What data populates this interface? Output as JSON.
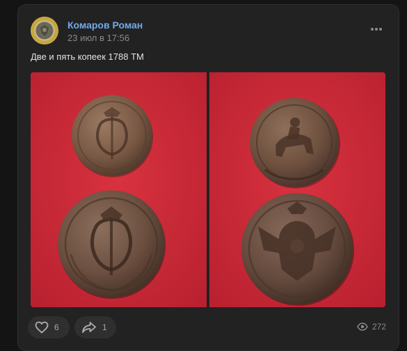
{
  "post": {
    "author": "Комаров Роман",
    "date": "23 июл в 17:56",
    "text": "Две и пять копеек 1788 ТМ",
    "photos": [
      {
        "subject": "coin-obverse-monogram-photo"
      },
      {
        "subject": "coin-reverse-eagle-photo"
      }
    ]
  },
  "actions": {
    "likes_count": "6",
    "shares_count": "1",
    "views_count": "272"
  },
  "icons": {
    "more": "more-horizontal-icon",
    "like": "heart-icon",
    "share": "share-arrow-icon",
    "views": "eye-icon"
  },
  "colors": {
    "background": "#141414",
    "card": "#222222",
    "author_link": "#71aaeb",
    "text": "#e1e3e6",
    "muted": "#8a8a8a",
    "photo_background": "#c8283a"
  }
}
